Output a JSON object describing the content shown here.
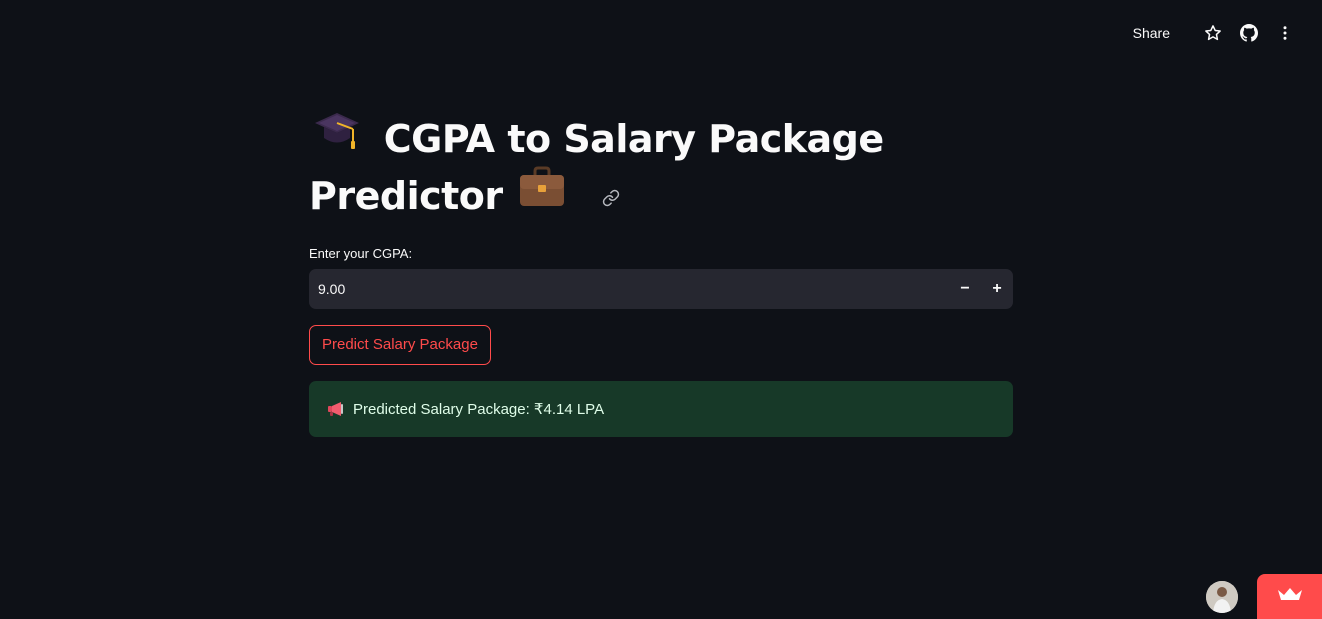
{
  "toolbar": {
    "share_label": "Share",
    "icons": [
      "star-icon",
      "github-icon",
      "more-vertical-icon"
    ]
  },
  "main": {
    "title_line1": "CGPA to Salary Package",
    "title_line2": "Predictor",
    "title_emoji_start": "graduation-cap-icon",
    "title_emoji_end": "briefcase-icon",
    "input_label": "Enter your CGPA:",
    "input_value": "9.00",
    "decrement_label": "−",
    "increment_label": "+",
    "button_label": "Predict Salary Package",
    "result_text": "Predicted Salary Package: ₹4.14 LPA",
    "result_icon": "megaphone-icon"
  },
  "colors": {
    "background": "#0e1117",
    "input_bg": "#262730",
    "accent": "#ff4b4b",
    "success_bg": "#173928",
    "success_text": "#dffde9"
  }
}
